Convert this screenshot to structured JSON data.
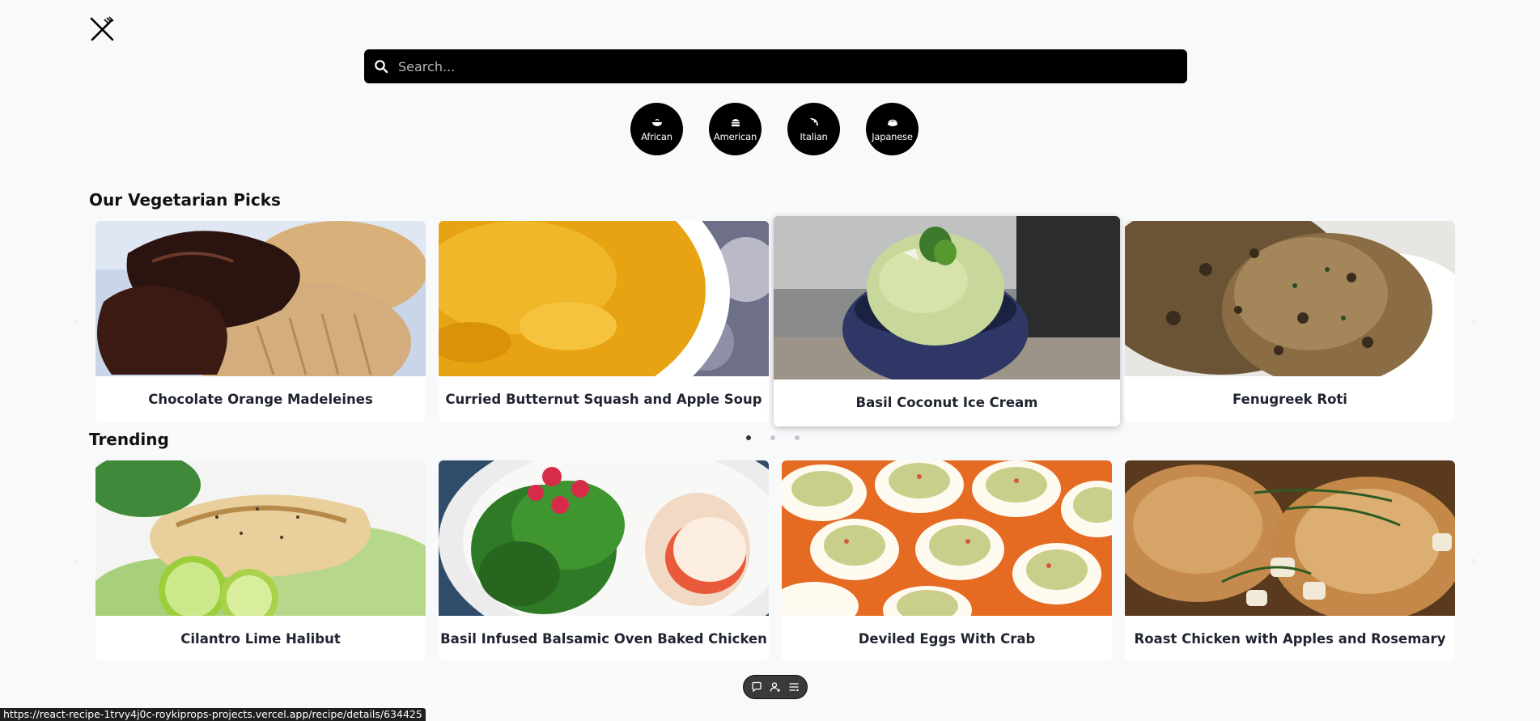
{
  "header": {
    "logo_icon": "fork-knife-icon",
    "search": {
      "placeholder": "Search...",
      "value": ""
    }
  },
  "cuisines": [
    {
      "label": "African",
      "icon": "bowl-icon"
    },
    {
      "label": "American",
      "icon": "burger-icon"
    },
    {
      "label": "Italian",
      "icon": "pizza-icon"
    },
    {
      "label": "Japanese",
      "icon": "sushi-icon"
    }
  ],
  "vegetarian": {
    "title": "Our Vegetarian Picks",
    "cards": [
      {
        "title": "Chocolate Orange Madeleines"
      },
      {
        "title": "Curried Butternut Squash and Apple Soup"
      },
      {
        "title": "Basil Coconut Ice Cream"
      },
      {
        "title": "Fenugreek Roti"
      }
    ]
  },
  "trending": {
    "title": "Trending",
    "pagination_pages": 3,
    "active_page": 1,
    "cards": [
      {
        "title": "Cilantro Lime Halibut"
      },
      {
        "title": "Basil Infused Balsamic Oven Baked Chicken"
      },
      {
        "title": "Deviled Eggs With Crab"
      },
      {
        "title": "Roast Chicken with Apples and Rosemary"
      }
    ]
  },
  "toolbar": {
    "icons": [
      "chat-icon",
      "user-add-icon",
      "list-icon"
    ]
  },
  "status_bar": {
    "url": "https://react-recipe-1trvy4j0c-roykiprops-projects.vercel.app/recipe/details/634425"
  }
}
